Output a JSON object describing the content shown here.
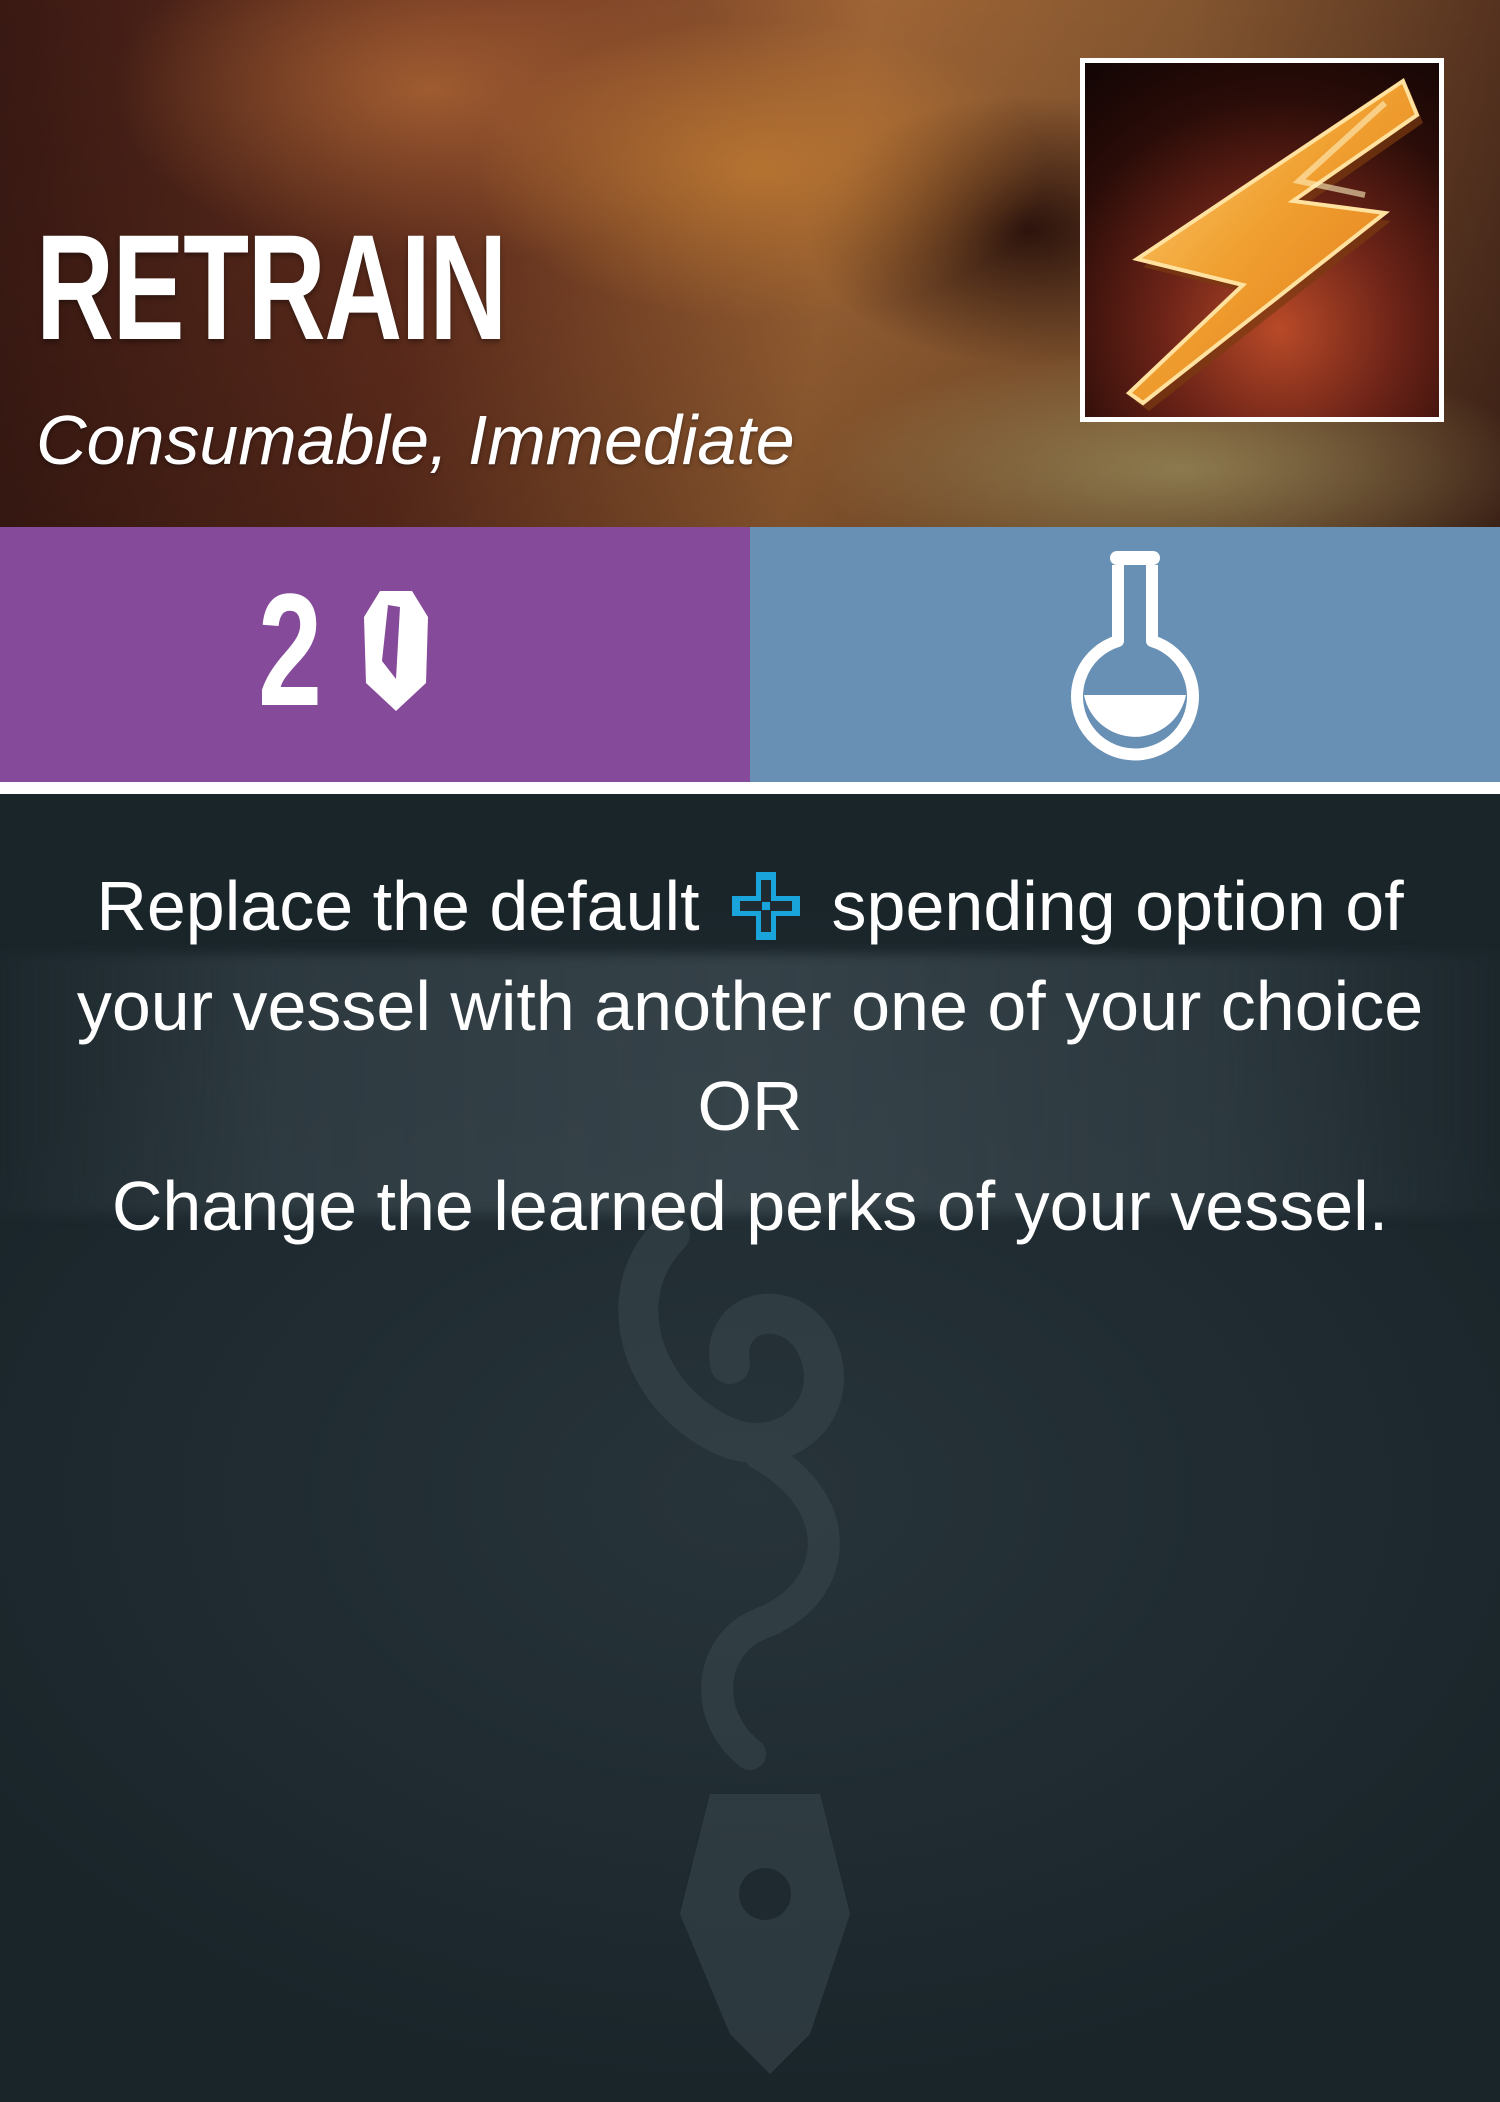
{
  "card": {
    "title": "RETRAIN",
    "subtitle": "Consumable, Immediate",
    "portrait_icon": "lightning-bolt-icon",
    "cost": {
      "value": "2",
      "icon": "crystal-icon",
      "color": "#864a9a"
    },
    "type": {
      "icon": "flask-icon",
      "color": "#6890b4"
    },
    "description": {
      "line1_before": "Replace the default",
      "line1_icon": "dpad-icon",
      "line1_after": "spending option of",
      "line2": "your vessel with another one of your choice",
      "line3": "OR",
      "line4": "Change the learned perks of your vessel."
    },
    "colors": {
      "accent_icon": "#1aa4dc",
      "text": "#ffffff",
      "background": "#1f2b31"
    }
  }
}
